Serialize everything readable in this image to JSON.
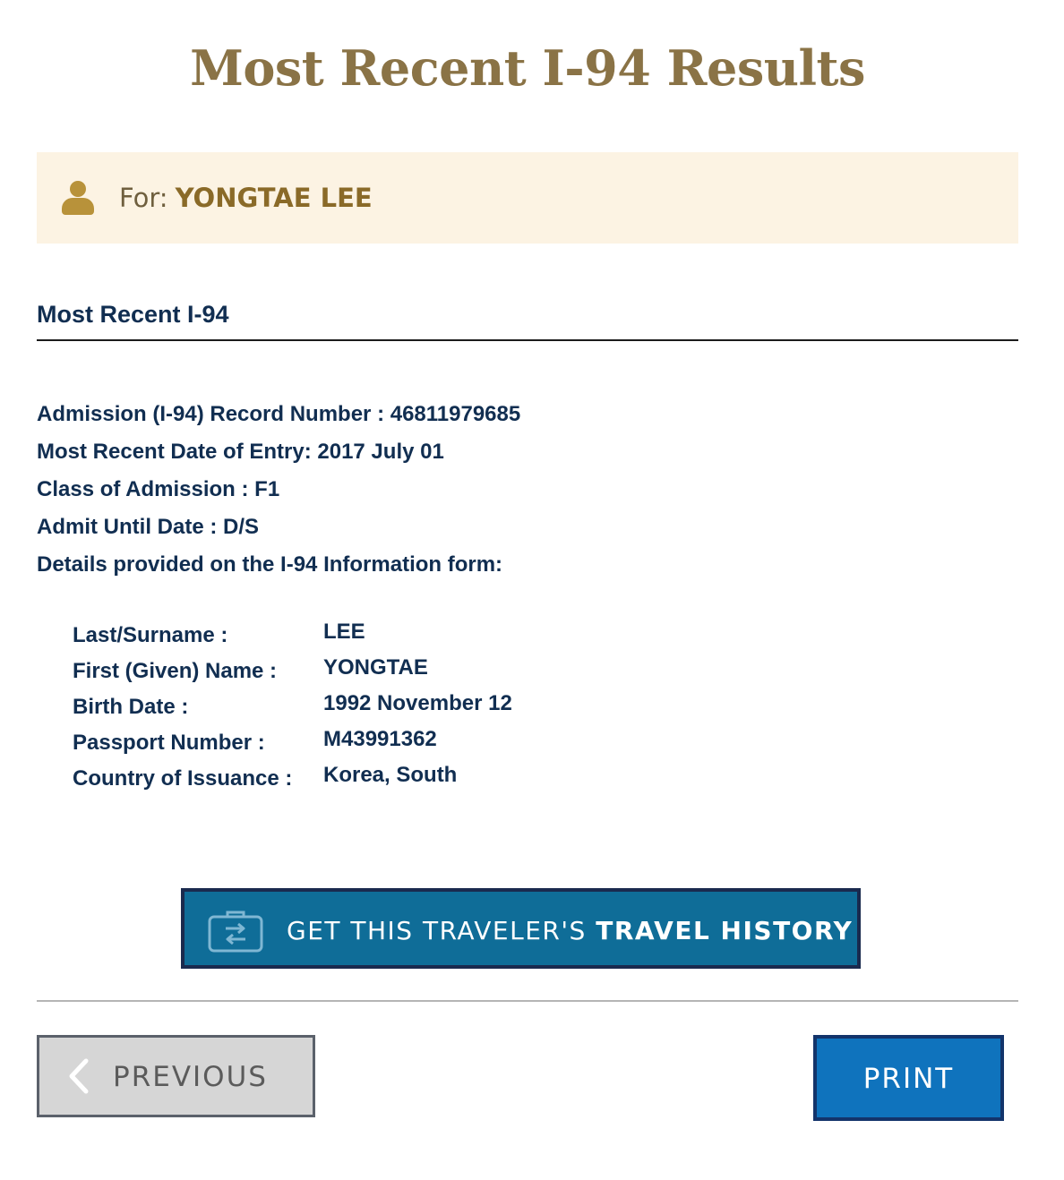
{
  "page": {
    "title": "Most Recent I-94 Results"
  },
  "traveler": {
    "for_label": "For:",
    "name": "YONGTAE LEE"
  },
  "section": {
    "heading": "Most Recent I-94"
  },
  "record": {
    "lines": [
      "Admission (I-94) Record Number : 46811979685",
      "Most Recent Date of Entry: 2017 July 01",
      "Class of Admission : F1",
      "Admit Until Date : D/S",
      "Details provided on the I-94 Information form:"
    ]
  },
  "form_details": [
    {
      "label": "Last/Surname :",
      "value": "LEE"
    },
    {
      "label": "First (Given) Name :",
      "value": "YONGTAE"
    },
    {
      "label": "Birth Date :",
      "value": "1992 November 12"
    },
    {
      "label": "Passport Number :",
      "value": "M43991362"
    },
    {
      "label": "Country of Issuance :",
      "value": "Korea, South"
    }
  ],
  "buttons": {
    "travel_history_prefix": "GET THIS TRAVELER'S ",
    "travel_history_bold": "TRAVEL HISTORY",
    "previous": "PREVIOUS",
    "print": "PRINT"
  },
  "icons": {
    "person": "person-icon",
    "suitcase": "suitcase-icon",
    "chevron": "chevron-left-icon"
  },
  "colors": {
    "title_gold": "#8a7346",
    "banner_bg": "#fcf3e3",
    "navy_text": "#112e51",
    "travel_button": "#0f6d98",
    "print_button": "#0f73bd"
  }
}
